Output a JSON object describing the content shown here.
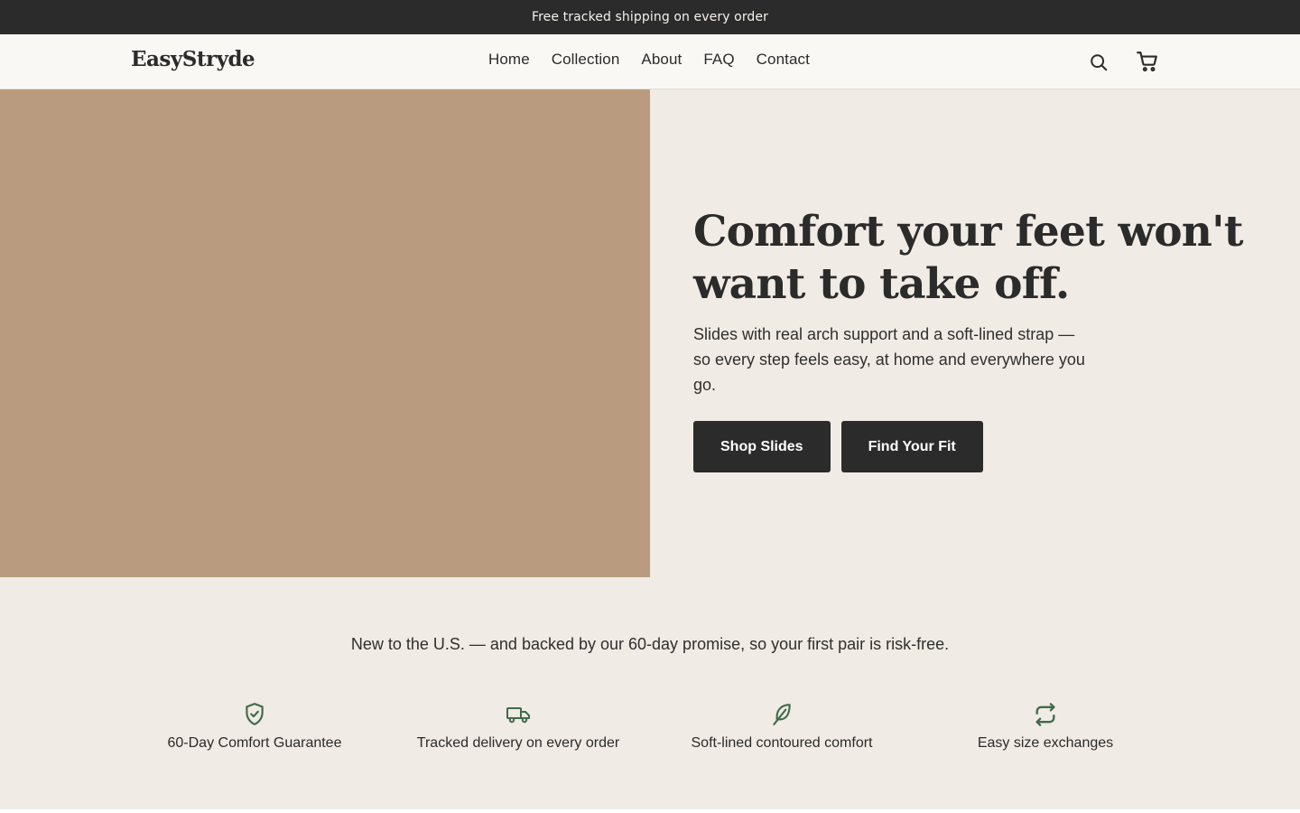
{
  "announcement": "Free tracked shipping on every order",
  "header": {
    "logo": "EasyStryde",
    "nav": [
      "Home",
      "Collection",
      "About",
      "FAQ",
      "Contact"
    ],
    "icons": {
      "search": "search-icon",
      "cart": "cart-icon"
    }
  },
  "hero": {
    "title": "Comfort your feet won't want to take off.",
    "subtitle": "Slides with real arch support and a soft-lined strap — so every step feels easy, at home and everywhere you go.",
    "primary_button": "Shop Slides",
    "secondary_button": "Find Your Fit",
    "image_color": "#b99c80"
  },
  "promise": "New to the U.S. — and backed by our 60-day promise, so your first pair is risk-free.",
  "features": [
    {
      "icon": "shield-check-icon",
      "label": "60-Day Comfort Guarantee"
    },
    {
      "icon": "truck-icon",
      "label": "Tracked delivery on every order"
    },
    {
      "icon": "feather-icon",
      "label": "Soft-lined contoured comfort"
    },
    {
      "icon": "exchange-icon",
      "label": "Easy size exchanges"
    }
  ],
  "colors": {
    "accent": "#3f6b4c",
    "dark": "#2b2b2b",
    "background": "#f0ebe4"
  }
}
